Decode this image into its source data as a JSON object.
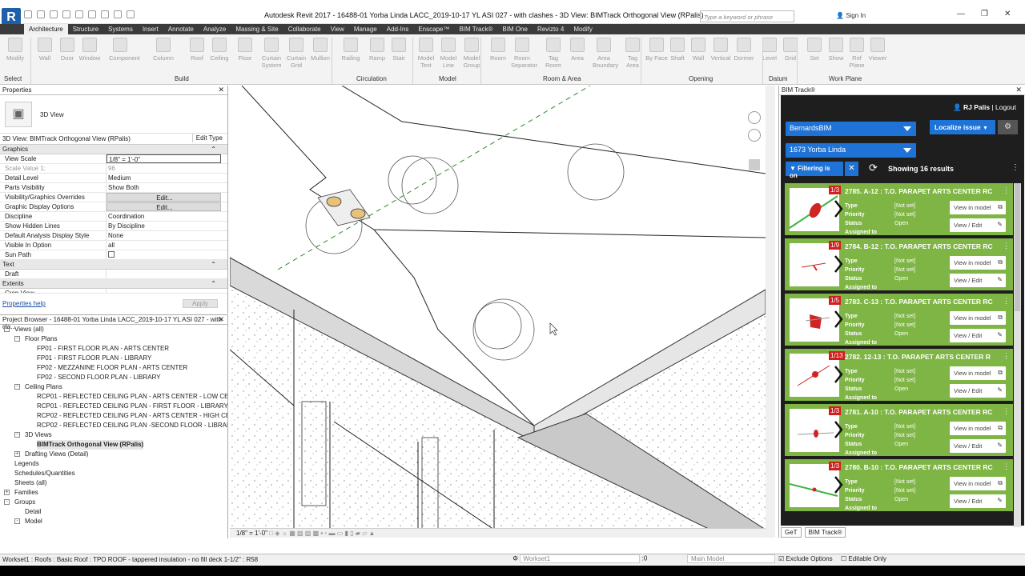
{
  "window": {
    "title": "Autodesk Revit 2017 -    16488-01 Yorba Linda LACC_2019-10-17 YL ASI 027 - with clashes - 3D View: BIMTrack Orthogonal View (RPalis)",
    "search_placeholder": "Type a keyword or phrase",
    "signin": "Sign In"
  },
  "ribbon_tabs": [
    "Architecture",
    "Structure",
    "Systems",
    "Insert",
    "Annotate",
    "Analyze",
    "Massing & Site",
    "Collaborate",
    "View",
    "Manage",
    "Add-Ins",
    "Enscape™",
    "BIM Track®",
    "BIM One",
    "Revizto 4",
    "Modify"
  ],
  "ribbon": {
    "buttons": [
      "Modify",
      "Wall",
      "Door",
      "Window",
      "Component",
      "Column",
      "Roof",
      "Ceiling",
      "Floor",
      "Curtain System",
      "Curtain Grid",
      "Mullion",
      "Railing",
      "Ramp",
      "Stair",
      "Model Text",
      "Model Line",
      "Model Group",
      "Room",
      "Room Separator",
      "Tag Room",
      "Area",
      "Area Boundary",
      "Tag Area",
      "By Face",
      "Shaft",
      "Wall",
      "Vertical",
      "Dormer",
      "Level",
      "Grid",
      "Set",
      "Show",
      "Ref Plane",
      "Viewer"
    ],
    "groups": [
      "Select",
      "Build",
      "Circulation",
      "Model",
      "Room & Area",
      "Opening",
      "Datum",
      "Work Plane"
    ]
  },
  "properties": {
    "title": "Properties",
    "type_name": "3D View",
    "view_selector": "3D View: BIMTrack Orthogonal View (RPalis)",
    "edit_type": "Edit Type",
    "graphics_label": "Graphics",
    "rows": [
      {
        "k": "View Scale",
        "v": "1/8\" = 1'-0\""
      },
      {
        "k": "Scale Value    1:",
        "v": "96"
      },
      {
        "k": "Detail Level",
        "v": "Medium"
      },
      {
        "k": "Parts Visibility",
        "v": "Show Both"
      },
      {
        "k": "Visibility/Graphics Overrides",
        "v": "Edit..."
      },
      {
        "k": "Graphic Display Options",
        "v": "Edit..."
      },
      {
        "k": "Discipline",
        "v": "Coordination"
      },
      {
        "k": "Show Hidden Lines",
        "v": "By Discipline"
      },
      {
        "k": "Default Analysis Display Style",
        "v": "None"
      },
      {
        "k": "Visible In Option",
        "v": "all"
      },
      {
        "k": "Sun Path",
        "v": ""
      }
    ],
    "text_label": "Text",
    "draft_label": "Draft",
    "extents_label": "Extents",
    "crop_label": "Crop View",
    "help": "Properties help",
    "apply": "Apply"
  },
  "browser": {
    "title": "Project Browser - 16488-01 Yorba Linda LACC_2019-10-17 YL ASI 027 - with cla...",
    "items": [
      {
        "t": "Views (all)",
        "lvl": 0,
        "tg": "-"
      },
      {
        "t": "Floor Plans",
        "lvl": 1,
        "tg": "-"
      },
      {
        "t": "FP01 - FIRST FLOOR PLAN - ARTS CENTER",
        "lvl": 2,
        "tg": ""
      },
      {
        "t": "FP01 - FIRST FLOOR PLAN - LIBRARY",
        "lvl": 2,
        "tg": ""
      },
      {
        "t": "FP02 - MEZZANINE FLOOR PLAN - ARTS CENTER",
        "lvl": 2,
        "tg": ""
      },
      {
        "t": "FP02 - SECOND FLOOR PLAN - LIBRARY",
        "lvl": 2,
        "tg": ""
      },
      {
        "t": "Ceiling Plans",
        "lvl": 1,
        "tg": "-"
      },
      {
        "t": "RCP01 - REFLECTED CEILING PLAN - ARTS CENTER - LOW CEILIN",
        "lvl": 2,
        "tg": ""
      },
      {
        "t": "RCP01 - REFLECTED CEILING PLAN - FIRST FLOOR - LIBRARY",
        "lvl": 2,
        "tg": ""
      },
      {
        "t": "RCP02 - REFLECTED CEILING PLAN - ARTS CENTER - HIGH CEILIN",
        "lvl": 2,
        "tg": ""
      },
      {
        "t": "RCP02 - REFLECTED CEILING PLAN -SECOND FLOOR - LIBRARY",
        "lvl": 2,
        "tg": ""
      },
      {
        "t": "3D Views",
        "lvl": 1,
        "tg": "-"
      },
      {
        "t": "BIMTrack Orthogonal View (RPalis)",
        "lvl": 2,
        "tg": "",
        "sel": true
      },
      {
        "t": "Drafting Views (Detail)",
        "lvl": 1,
        "tg": "+"
      },
      {
        "t": "Legends",
        "lvl": 0,
        "tg": ""
      },
      {
        "t": "Schedules/Quantities",
        "lvl": 0,
        "tg": ""
      },
      {
        "t": "Sheets (all)",
        "lvl": 0,
        "tg": ""
      },
      {
        "t": "Families",
        "lvl": 0,
        "tg": "+"
      },
      {
        "t": "Groups",
        "lvl": 0,
        "tg": "-"
      },
      {
        "t": "Detail",
        "lvl": 1,
        "tg": ""
      },
      {
        "t": "Model",
        "lvl": 1,
        "tg": "-"
      }
    ]
  },
  "view_control": {
    "scale": "1/8\" = 1'-0\""
  },
  "bimtrack": {
    "title": "BIM Track®",
    "user": "RJ Palis",
    "logout": "Logout",
    "hub": "BernardsBIM",
    "project": "1673 Yorba Linda",
    "localize": "Localize issue",
    "filter": "Filtering is on",
    "results": "Showing 16 results",
    "field_labels": [
      "Type",
      "Priority",
      "Status",
      "Assigned to"
    ],
    "btn_view_model": "View in model",
    "btn_view_edit": "View / Edit",
    "issues": [
      {
        "count": "1/3",
        "title": "2785. A-12 : T.O. PARAPET ARTS CENTER RC",
        "type": "[Not set]",
        "priority": "[Not set]",
        "status": "Open"
      },
      {
        "count": "1/9",
        "title": "2784. B-12 : T.O. PARAPET ARTS CENTER RC",
        "type": "[Not set]",
        "priority": "[Not set]",
        "status": "Open"
      },
      {
        "count": "1/5",
        "title": "2783. C-13 : T.O. PARAPET ARTS CENTER RC",
        "type": "[Not set]",
        "priority": "[Not set]",
        "status": "Open"
      },
      {
        "count": "1/13",
        "title": "2782. 12-13 : T.O. PARAPET ARTS CENTER R",
        "type": "[Not set]",
        "priority": "[Not set]",
        "status": "Open"
      },
      {
        "count": "1/3",
        "title": "2781. A-10 : T.O. PARAPET ARTS CENTER RC",
        "type": "[Not set]",
        "priority": "[Not set]",
        "status": "Open"
      },
      {
        "count": "1/3",
        "title": "2780. B-10 : T.O. PARAPET ARTS CENTER RC",
        "type": "[Not set]",
        "priority": "[Not set]",
        "status": "Open"
      }
    ],
    "tabs": [
      "GeT",
      "BIM Track®"
    ]
  },
  "status": {
    "message": "Workset1 : Roofs : Basic Roof : TPO ROOF - tappered insulation - no fill deck 1-1/2\" : R58",
    "workset": "Workset1",
    "workset_count": ":0",
    "main_model": "Main Model",
    "exclude_options": "Exclude Options",
    "editable_only": "Editable Only"
  }
}
